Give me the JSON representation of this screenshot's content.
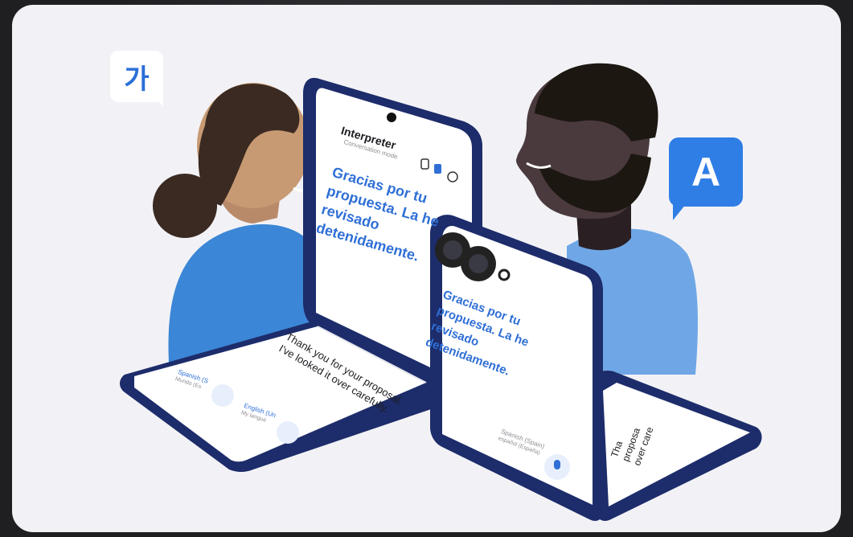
{
  "bubbles": {
    "korean_glyph": "가",
    "latin_glyph": "A"
  },
  "phone_left": {
    "app_title": "Interpreter",
    "app_subtitle": "Conversation mode",
    "translated_text": "Gracias por tu propuesta. La he revisado detenidamente.",
    "source_text": "Thank you for your proposal. I've looked it over carefully.",
    "lang_a": "Spanish (S",
    "lang_a_sub": "Mundo (Es",
    "lang_b": "English (Un",
    "lang_b_sub": "My langua"
  },
  "phone_right": {
    "translated_text": "Gracias por tu propuesta. La he revisado detenidamente.",
    "lang_label": "Spanish (Spain)",
    "lang_sub": "español (España)",
    "source_fragment": "Tha proposa over care"
  },
  "colors": {
    "accent_blue": "#2f6fd6",
    "bubble_blue": "#2f7ee6",
    "phone_frame": "#1d2c6a",
    "shirt_blue": "#3b86d6",
    "shirt_light": "#6fa7e6"
  }
}
